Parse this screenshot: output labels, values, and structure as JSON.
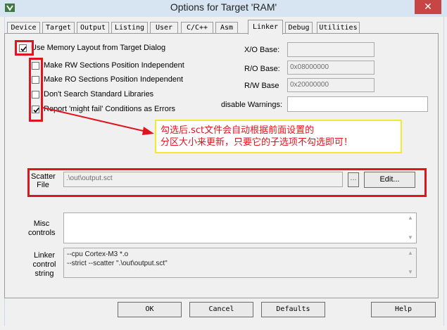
{
  "window": {
    "title": "Options for Target 'RAM'",
    "close_glyph": "✕"
  },
  "tabs": [
    "Device",
    "Target",
    "Output",
    "Listing",
    "User",
    "C/C++",
    "Asm",
    "Linker",
    "Debug",
    "Utilities"
  ],
  "active_tab": "Linker",
  "options": {
    "use_memory_layout": {
      "label": "Use Memory Layout from Target Dialog",
      "checked": true
    },
    "make_rw": {
      "label": "Make RW Sections Position Independent",
      "checked": false
    },
    "make_ro": {
      "label": "Make RO Sections Position Independent",
      "checked": false
    },
    "dont_search": {
      "label": "Don't Search Standard Libraries",
      "checked": false
    },
    "report_might_fail": {
      "label": "Report 'might fail' Conditions as Errors",
      "checked": true
    }
  },
  "addresses": {
    "xo_label": "X/O Base:",
    "xo_value": "",
    "ro_label": "R/O Base:",
    "ro_value": "0x08000000",
    "rw_label": "R/W Base",
    "rw_value": "0x20000000",
    "warnings_label": "disable Warnings:",
    "warnings_value": ""
  },
  "annotation": {
    "line1": "勾选后.sct文件会自动根据前面设置的",
    "line2": "分区大小来更新，只要它的子选项不勾选即可！",
    "color": "#e0141e",
    "border_color": "#f3ea2f"
  },
  "scatter": {
    "label_line1": "Scatter",
    "label_line2": "File",
    "value": ".\\out\\output.sct",
    "browse_label": "...",
    "edit_label": "Edit..."
  },
  "misc": {
    "label_line1": "Misc",
    "label_line2": "controls",
    "value": ""
  },
  "linker_control": {
    "label_line1": "Linker",
    "label_line2": "control",
    "label_line3": "string",
    "line1": "--cpu Cortex-M3 *.o",
    "line2": "--strict --scatter \".\\out\\output.sct\""
  },
  "buttons": {
    "ok": "OK",
    "cancel": "Cancel",
    "defaults": "Defaults",
    "help": "Help"
  },
  "colors": {
    "highlight_red": "#e0141e",
    "titlebar": "#d7e4f2",
    "close": "#c74545"
  }
}
